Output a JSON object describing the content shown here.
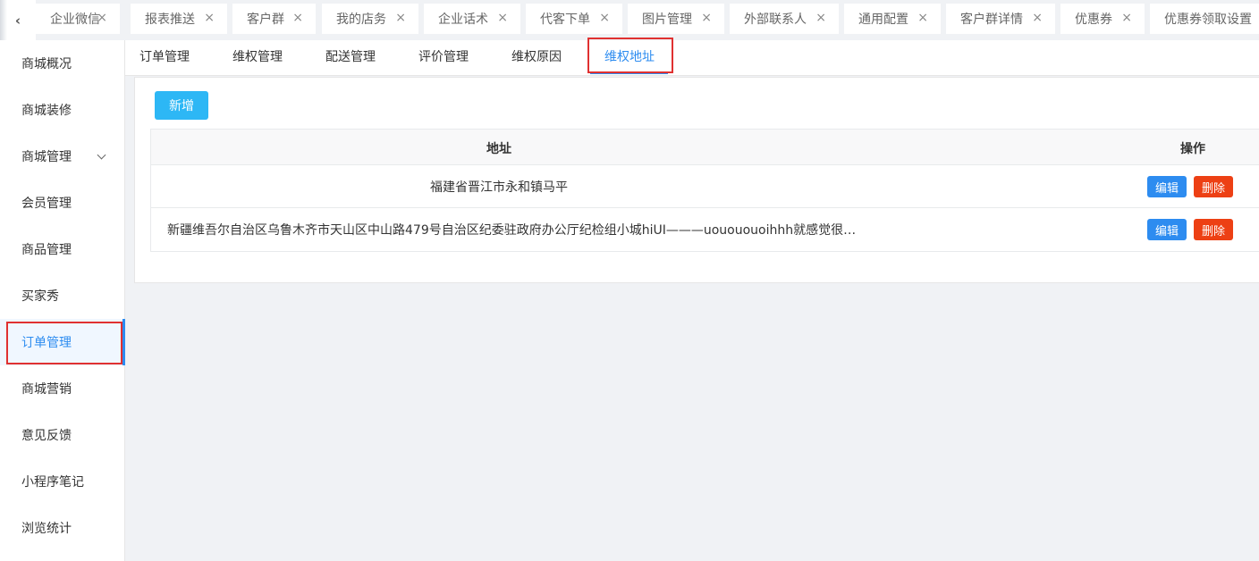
{
  "tabbar": {
    "back_icon": "chevron-left-icon",
    "tabs": [
      {
        "label": "企业微信"
      },
      {
        "label": "报表推送"
      },
      {
        "label": "客户群"
      },
      {
        "label": "我的店务"
      },
      {
        "label": "企业话术"
      },
      {
        "label": "代客下单"
      },
      {
        "label": "图片管理"
      },
      {
        "label": "外部联系人"
      },
      {
        "label": "通用配置"
      },
      {
        "label": "客户群详情"
      },
      {
        "label": "优惠券"
      },
      {
        "label": "优惠券领取设置"
      }
    ],
    "close_glyph": "×"
  },
  "sidebar": {
    "items": [
      {
        "label": "商城概况"
      },
      {
        "label": "商城装修"
      },
      {
        "label": "商城管理"
      },
      {
        "label": "会员管理"
      },
      {
        "label": "商品管理"
      },
      {
        "label": "买家秀"
      },
      {
        "label": "订单管理"
      },
      {
        "label": "商城营销"
      },
      {
        "label": "意见反馈"
      },
      {
        "label": "小程序笔记"
      },
      {
        "label": "浏览统计"
      }
    ],
    "active_index": 6
  },
  "subtabs": {
    "items": [
      {
        "label": "订单管理"
      },
      {
        "label": "维权管理"
      },
      {
        "label": "配送管理"
      },
      {
        "label": "评价管理"
      },
      {
        "label": "维权原因"
      },
      {
        "label": "维权地址"
      }
    ],
    "active_index": 5
  },
  "main": {
    "add_button": "新增",
    "table": {
      "columns": [
        "地址",
        "操作"
      ],
      "rows": [
        {
          "address": "福建省晋江市永和镇马平",
          "edit": "编辑",
          "delete": "删除"
        },
        {
          "address": "新疆维吾尔自治区乌鲁木齐市天山区中山路479号自治区纪委驻政府办公厅纪检组小城hiUI———uouououoihhh就感觉很…",
          "edit": "编辑",
          "delete": "删除"
        }
      ]
    }
  },
  "colors": {
    "accent": "#2d8cf0",
    "add_button": "#2db7f5",
    "delete_button": "#ed4014",
    "highlight_box": "#e03131"
  }
}
